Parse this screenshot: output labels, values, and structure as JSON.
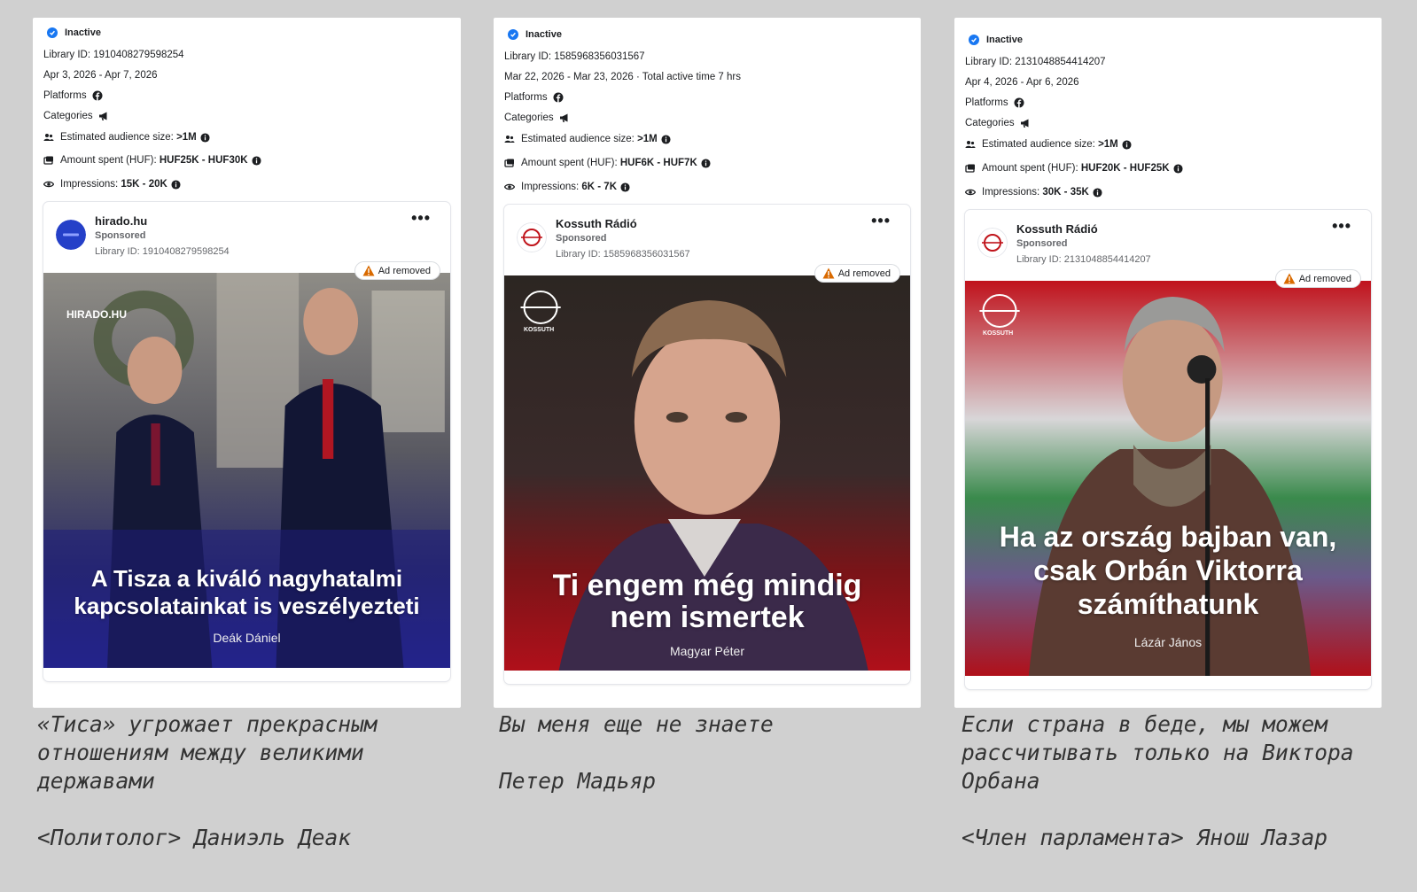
{
  "cards": [
    {
      "status": "Inactive",
      "library_id_line": "Library ID: 1910408279598254",
      "dates": "Apr 3, 2026 - Apr 7, 2026",
      "platforms_label": "Platforms",
      "categories_label": "Categories",
      "audience_label": "Estimated audience size:",
      "audience_value": ">1M",
      "amount_label": "Amount spent (HUF):",
      "amount_value": "HUF25K - HUF30K",
      "impressions_label": "Impressions:",
      "impressions_value": "15K - 20K",
      "page_name": "hirado.hu",
      "sponsored": "Sponsored",
      "post_library_id": "Library ID: 1910408279598254",
      "removed_label": "Ad removed",
      "watermark": "HIRADO.HU",
      "headline": "A Tisza a kiváló nagyhatalmi kapcsolatainkat is veszélyezteti",
      "author": "Deák Dániel",
      "caption": "«Тиса» угрожает прекрасным\nотношениям между великими\nдержавами\n\n<Политолог> Даниэль Деак"
    },
    {
      "status": "Inactive",
      "library_id_line": "Library ID: 1585968356031567",
      "dates": "Mar 22, 2026 - Mar 23, 2026 · Total active time 7 hrs",
      "platforms_label": "Platforms",
      "categories_label": "Categories",
      "audience_label": "Estimated audience size:",
      "audience_value": ">1M",
      "amount_label": "Amount spent (HUF):",
      "amount_value": "HUF6K - HUF7K",
      "impressions_label": "Impressions:",
      "impressions_value": "6K - 7K",
      "page_name": "Kossuth Rádió",
      "sponsored": "Sponsored",
      "post_library_id": "Library ID: 1585968356031567",
      "removed_label": "Ad removed",
      "watermark": "KOSSUTH",
      "headline": "Ti engem még mindig nem ismertek",
      "author": "Magyar Péter",
      "caption": "Вы меня еще не знаете\n\nПетер Мадьяр"
    },
    {
      "status": "Inactive",
      "library_id_line": "Library ID: 2131048854414207",
      "dates": "Apr 4, 2026 - Apr 6, 2026",
      "platforms_label": "Platforms",
      "categories_label": "Categories",
      "audience_label": "Estimated audience size:",
      "audience_value": ">1M",
      "amount_label": "Amount spent (HUF):",
      "amount_value": "HUF20K - HUF25K",
      "impressions_label": "Impressions:",
      "impressions_value": "30K - 35K",
      "page_name": "Kossuth Rádió",
      "sponsored": "Sponsored",
      "post_library_id": "Library ID: 2131048854414207",
      "removed_label": "Ad removed",
      "watermark": "KOSSUTH",
      "headline": "Ha az ország bajban van, csak Orbán Viktorra számíthatunk",
      "author": "Lázár János",
      "caption": "Если страна в беде, мы можем\nрассчитывать только на Виктора\nОрбана\n\n<Член парламента> Янош Лазар"
    }
  ],
  "colors": {
    "page_bg": "#d0d0d0",
    "status_blue": "#1877f2",
    "warning": "#d96a00",
    "hirado_avatar": "#2540c8",
    "kossuth_red": "#c0141b"
  }
}
